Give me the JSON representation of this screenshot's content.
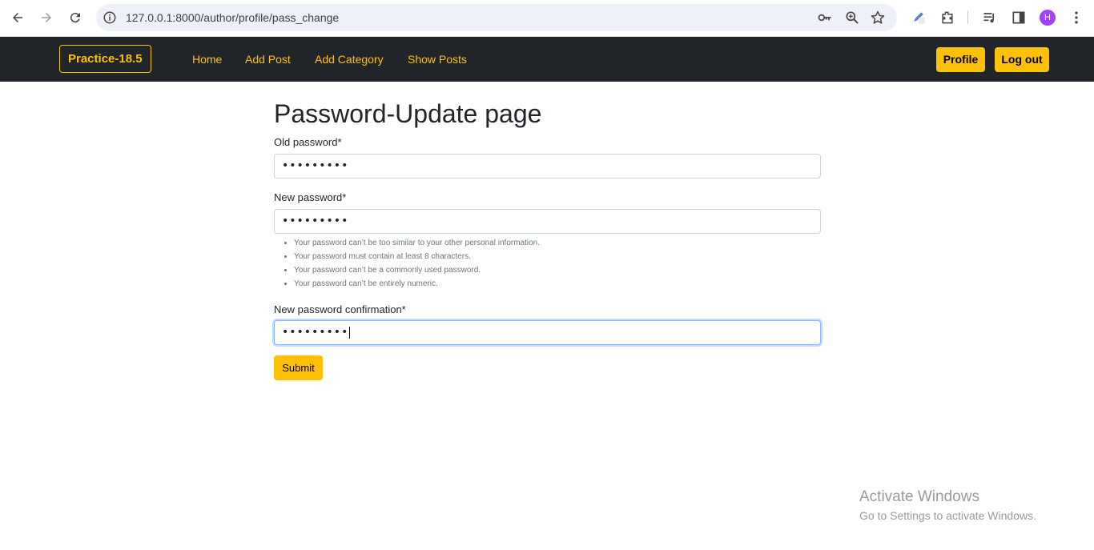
{
  "browser": {
    "url": "127.0.0.1:8000/author/profile/pass_change",
    "avatar_letter": "H"
  },
  "navbar": {
    "brand": "Practice-18.5",
    "links": [
      "Home",
      "Add Post",
      "Add Category",
      "Show Posts"
    ],
    "profile_label": "Profile",
    "logout_label": "Log out"
  },
  "form": {
    "title": "Password-Update page",
    "old_password_label": "Old password*",
    "old_password_value": "•••••••••",
    "new_password_label": "New password*",
    "new_password_value": "•••••••••",
    "help_items": [
      "Your password can’t be too similar to your other personal information.",
      "Your password must contain at least 8 characters.",
      "Your password can’t be a commonly used password.",
      "Your password can’t be entirely numeric."
    ],
    "confirm_label": "New password confirmation*",
    "confirm_value": "•••••••••",
    "submit_label": "Submit"
  },
  "watermark": {
    "line1": "Activate Windows",
    "line2": "Go to Settings to activate Windows."
  },
  "colors": {
    "accent": "#ffc107",
    "navbar_bg": "#212529"
  }
}
